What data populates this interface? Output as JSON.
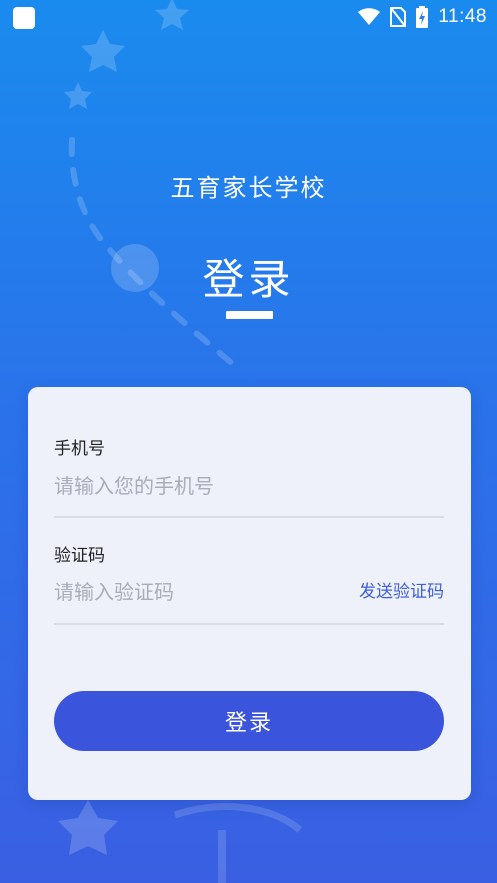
{
  "status_bar": {
    "time": "11:48",
    "icons": [
      "app-notification-icon",
      "wifi-icon",
      "no-sim-icon",
      "battery-charging-icon"
    ]
  },
  "header": {
    "school_name": "五育家长学校",
    "title": "登录"
  },
  "form": {
    "phone": {
      "label": "手机号",
      "placeholder": "请输入您的手机号",
      "value": ""
    },
    "code": {
      "label": "验证码",
      "placeholder": "请输入验证码",
      "value": "",
      "send_label": "发送验证码"
    },
    "submit_label": "登录"
  },
  "colors": {
    "background_top": "#1a8bee",
    "background_bottom": "#3a5fe2",
    "card": "#eef1fa",
    "button": "#3b54dc",
    "link": "#3e5fd9",
    "placeholder": "#a9adb7"
  }
}
